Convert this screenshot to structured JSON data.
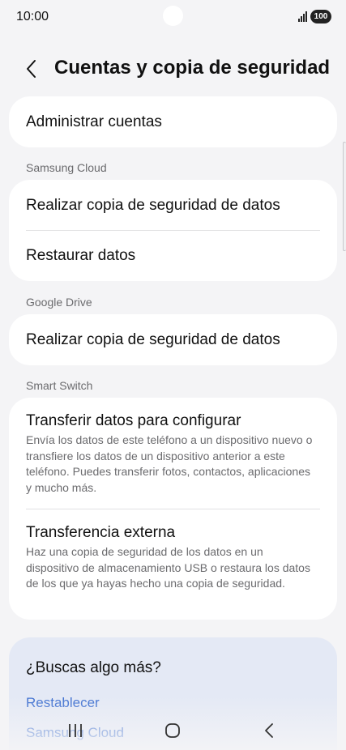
{
  "status_bar": {
    "time": "10:00",
    "battery": "100",
    "icons": [
      "signal-icon",
      "battery-icon"
    ]
  },
  "header": {
    "title": "Cuentas y copia de seguridad",
    "back_icon": "chevron-left-icon"
  },
  "accounts": {
    "manage": "Administrar cuentas"
  },
  "samsung_cloud": {
    "label": "Samsung Cloud",
    "backup": "Realizar copia de seguridad de datos",
    "restore": "Restaurar datos"
  },
  "google_drive": {
    "label": "Google Drive",
    "backup": "Realizar copia de seguridad de datos"
  },
  "smart_switch": {
    "label": "Smart Switch",
    "transfer_title": "Transferir datos para configurar",
    "transfer_desc": "Envía los datos de este teléfono a un dispositivo nuevo o transfiere los datos de un dispositivo anterior a este teléfono. Puedes transferir fotos, contactos, aplicaciones y mucho más.",
    "external_title": "Transferencia externa",
    "external_desc": "Haz una copia de seguridad de los datos en un dispositivo de almacenamiento USB o restaura los datos de los que ya hayas hecho una copia de seguridad."
  },
  "suggestions": {
    "title": "¿Buscas algo más?",
    "links": [
      "Restablecer",
      "Samsung Cloud"
    ]
  },
  "nav_bar": {
    "icons": [
      "recents-icon",
      "home-icon",
      "back-icon"
    ]
  },
  "colors": {
    "background": "#f4f4f6",
    "card": "#ffffff",
    "suggestion_card": "#e4e9f5",
    "link": "#3e6fd0",
    "secondary_text": "#6b6b6e"
  }
}
